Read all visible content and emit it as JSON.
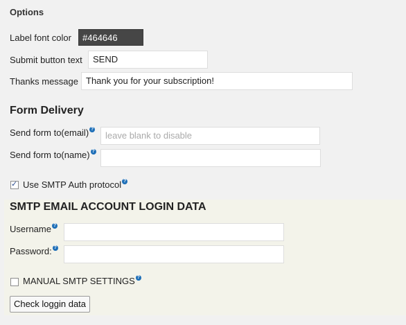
{
  "options": {
    "heading": "Options",
    "label_font_color": {
      "label": "Label font color",
      "value": "#464646"
    },
    "submit_button_text": {
      "label": "Submit button text",
      "value": "SEND"
    },
    "thanks_message": {
      "label": "Thanks message",
      "value": "Thank you for your subscription!"
    }
  },
  "delivery": {
    "heading": "Form Delivery",
    "send_to_email": {
      "label": "Send form to(email)",
      "value": "",
      "placeholder": "leave blank to disable"
    },
    "send_to_name": {
      "label": "Send form to(name)",
      "value": ""
    },
    "use_smtp": {
      "label": "Use SMTP Auth protocol",
      "checked": true
    }
  },
  "smtp": {
    "heading": "SMTP EMAIL ACCOUNT LOGIN DATA",
    "username": {
      "label": "Username",
      "value": ""
    },
    "password": {
      "label": "Password:",
      "value": ""
    },
    "manual_settings": {
      "label": "MANUAL SMTP SETTINGS",
      "checked": false
    },
    "check_button_label": "Check loggin data"
  },
  "help_icon_glyph": "?",
  "colors": {
    "label_font_color_swatch": "#464646",
    "help_icon": "#1e6fb8",
    "smtp_panel_bg": "#f3f3ea"
  }
}
